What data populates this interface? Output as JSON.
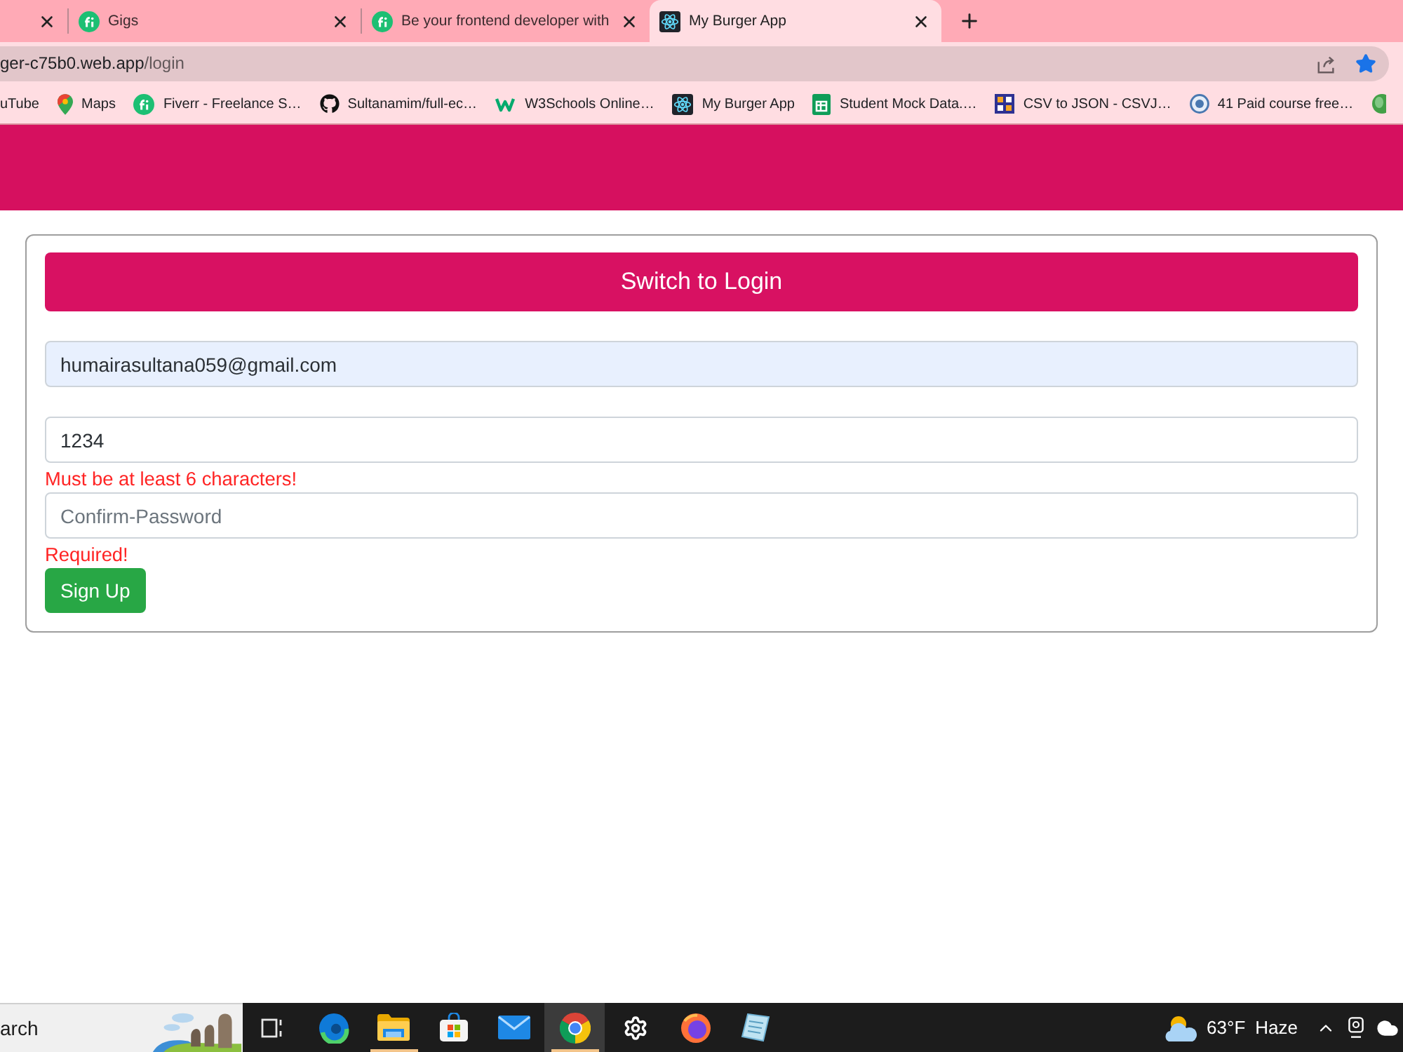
{
  "browser": {
    "tabs": [
      {
        "selected": false
      },
      {
        "kind": "round-logo",
        "title": "Gigs",
        "selected": false
      },
      {
        "kind": "round-logo",
        "title": "Be your frontend developer with",
        "selected": false
      },
      {
        "kind": "atom",
        "title": "My Burger App",
        "selected": true
      }
    ],
    "address": {
      "host": "ger-c75b0.web.app",
      "path": "/login",
      "bookmarked": true
    },
    "bookmarks": [
      {
        "kind": "text",
        "title": "uTube"
      },
      {
        "kind": "pin",
        "title": "Maps"
      },
      {
        "kind": "round-logo",
        "title": "Fiverr - Freelance S…"
      },
      {
        "kind": "cat",
        "title": "Sultanamim/full-ec…"
      },
      {
        "kind": "zigzag",
        "title": "W3Schools Online…"
      },
      {
        "kind": "atom",
        "title": "My Burger App"
      },
      {
        "kind": "sheet",
        "title": "Student Mock Data.…"
      },
      {
        "kind": "grid-logo",
        "title": "CSV to JSON - CSVJ…"
      },
      {
        "kind": "round-badge",
        "title": "41 Paid course free…"
      },
      {
        "kind": "globe"
      }
    ]
  },
  "app": {
    "switch_button": "Switch to Login",
    "fields": [
      {
        "value": "humairasultana059@gmail.com",
        "autofilled": true
      },
      {
        "value": "1234",
        "autofilled": false,
        "error": "Must be at least 6 characters!"
      },
      {
        "placeholder": "Confirm-Password",
        "autofilled": false,
        "error": "Required!"
      }
    ],
    "submit_button": "Sign Up"
  },
  "taskbar": {
    "search": {
      "placeholder": "arch"
    },
    "apps": [
      {
        "kind": "task-view",
        "selected": false,
        "running": false
      },
      {
        "kind": "swirl",
        "selected": false,
        "running": false
      },
      {
        "kind": "folder",
        "selected": false,
        "running": true
      },
      {
        "kind": "bag",
        "selected": false,
        "running": false
      },
      {
        "kind": "envelope",
        "selected": false,
        "running": false
      },
      {
        "kind": "ring-logo",
        "selected": true,
        "running": true
      },
      {
        "kind": "gear",
        "selected": false,
        "running": false
      },
      {
        "kind": "flame-globe",
        "selected": false,
        "running": false
      },
      {
        "kind": "notepad",
        "selected": false,
        "running": false
      }
    ],
    "weather": {
      "temperature": "63°F",
      "condition": "Haze"
    },
    "tray": [
      {
        "kind": "chevron"
      },
      {
        "kind": "webcam"
      },
      {
        "kind": "cloud"
      }
    ]
  }
}
